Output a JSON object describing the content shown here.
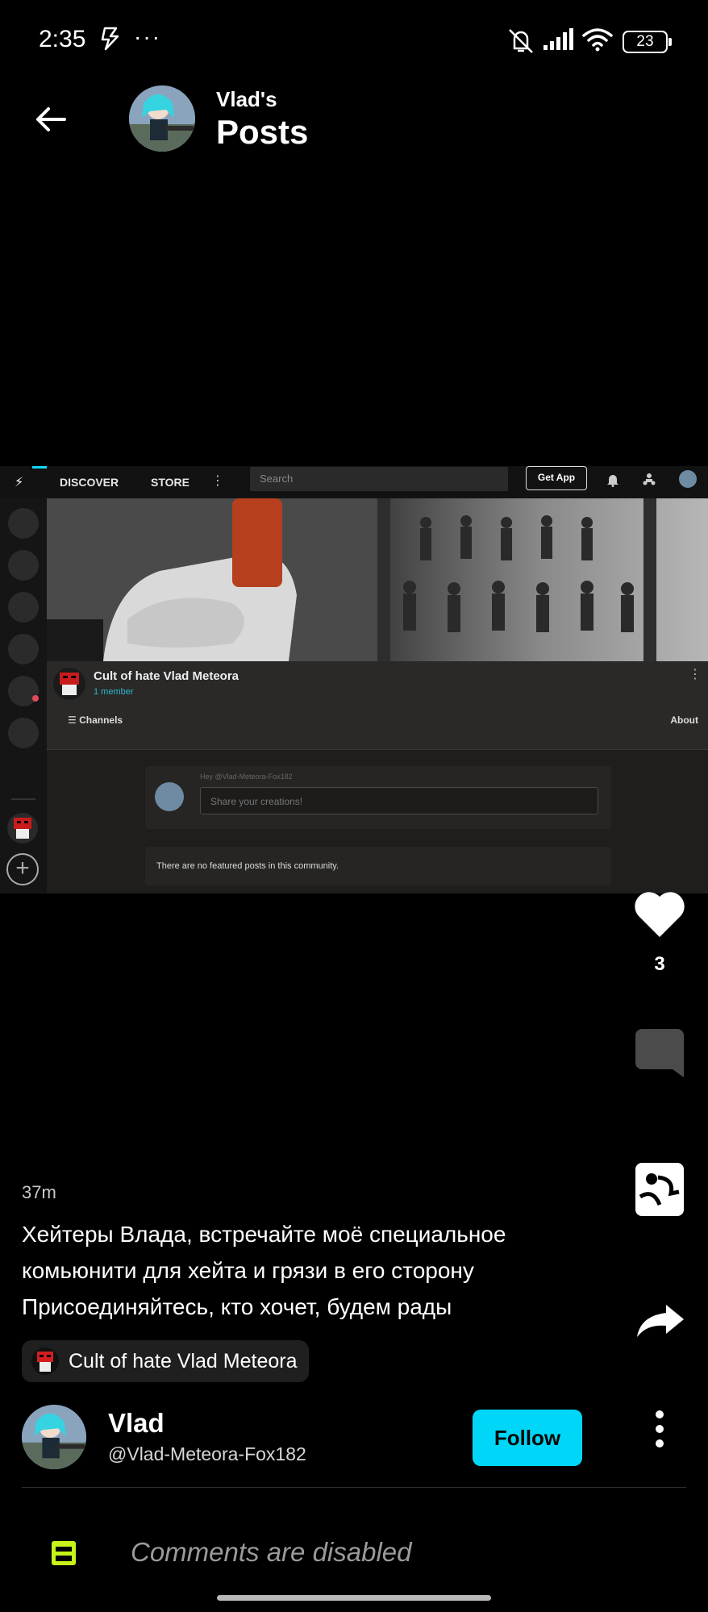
{
  "status_bar": {
    "time": "2:35",
    "dots": "···",
    "battery": "23"
  },
  "header": {
    "owner": "Vlad's",
    "title": "Posts"
  },
  "post_image": {
    "nav_discover": "DISCOVER",
    "nav_store": "STORE",
    "search_placeholder": "Search",
    "get_app": "Get App",
    "community_name": "Cult of hate Vlad Meteora",
    "member_count": "1 member",
    "channels": "Channels",
    "about": "About",
    "hey_text": "Hey @Vlad-Meteora-Fox182",
    "share_placeholder": "Share your creations!",
    "no_featured": "There are no featured posts in this community."
  },
  "actions": {
    "like_count": "3"
  },
  "post": {
    "time_ago": "37m",
    "caption_lines": [
      "Хейтеры Влада, встречайте моё специальное",
      "комьюнити для хейта и грязи в его сторону",
      "Присоединяйтесь, кто хочет, будем рады"
    ],
    "community_chip": "Cult of hate Vlad Meteora"
  },
  "author": {
    "name": "Vlad",
    "handle": "@Vlad-Meteora-Fox182",
    "follow_label": "Follow"
  },
  "comments": {
    "disabled_text": "Comments are disabled"
  },
  "colors": {
    "accent": "#00d6f7",
    "comment_icon": "#c6f31a",
    "background": "#000000"
  }
}
